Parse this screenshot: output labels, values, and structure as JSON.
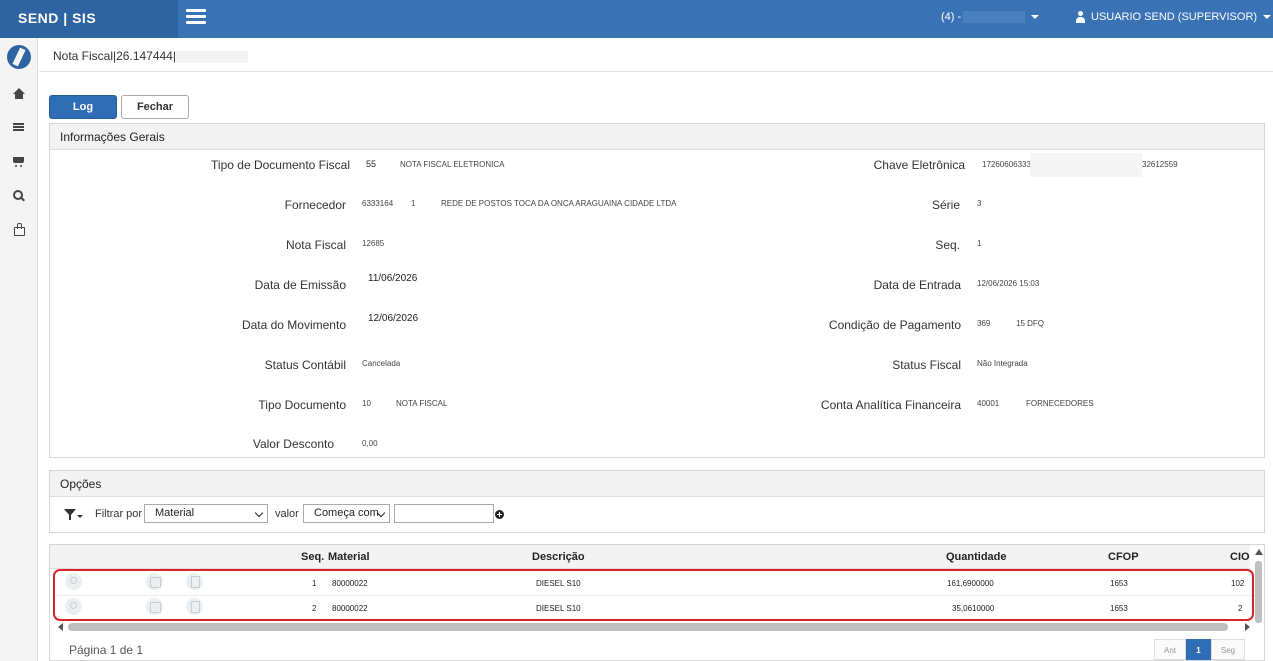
{
  "app": {
    "brand": "SEND | SIS",
    "company": "(4) -",
    "user": "USUARIO SEND (SUPERVISOR)"
  },
  "breadcrumb": "Nota Fiscal|26.147444|",
  "toolbar": {
    "log_label": "Log",
    "close_label": "Fechar"
  },
  "info": {
    "title": "Informações Gerais",
    "tipo_doc_fiscal": {
      "label": "Tipo de Documento Fiscal",
      "code": "55",
      "text": "NOTA FISCAL ELETRONICA"
    },
    "fornecedor": {
      "label": "Fornecedor",
      "code": "6333164",
      "seq": "1",
      "name": "REDE DE POSTOS TOCA DA ONCA ARAGUAINA CIDADE LTDA"
    },
    "nota_fiscal": {
      "label": "Nota Fiscal",
      "value": "12685"
    },
    "data_emissao": {
      "label": "Data de Emissão",
      "value": "11/06/2026"
    },
    "data_movimento": {
      "label": "Data do Movimento",
      "value": "12/06/2026"
    },
    "status_contabil": {
      "label": "Status Contábil",
      "value": "Cancelada"
    },
    "tipo_documento": {
      "label": "Tipo Documento",
      "code": "10",
      "text": "NOTA FISCAL"
    },
    "valor_desconto": {
      "label": "Valor Desconto",
      "value": "0,00"
    },
    "chave_eletronica": {
      "label": "Chave Eletrônica",
      "start": "17260606333",
      "end": "32612559"
    },
    "serie": {
      "label": "Série",
      "value": "3"
    },
    "seq": {
      "label": "Seq.",
      "value": "1"
    },
    "data_entrada": {
      "label": "Data de Entrada",
      "value": "12/06/2026 15:03"
    },
    "condicao_pagamento": {
      "label": "Condição de Pagamento",
      "code": "369",
      "text": "15 DFQ"
    },
    "status_fiscal": {
      "label": "Status Fiscal",
      "value": "Não Integrada"
    },
    "conta_analitica": {
      "label": "Conta Analítica Financeira",
      "code": "40001",
      "text": "FORNECEDORES"
    }
  },
  "options": {
    "title": "Opções",
    "filter_by_label": "Filtrar por",
    "filter_field": "Material",
    "value_label": "valor",
    "operator": "Começa com",
    "search_value": ""
  },
  "grid": {
    "headers": {
      "seq": "Seq.",
      "material": "Material",
      "descricao": "Descrição",
      "quantidade": "Quantidade",
      "cfop": "CFOP",
      "cio": "CIO"
    },
    "rows": [
      {
        "seq": "1",
        "material": "80000022",
        "descricao": "DIESEL S10",
        "quantidade": "161,6900000",
        "cfop": "1653",
        "cio": "102"
      },
      {
        "seq": "2",
        "material": "80000022",
        "descricao": "DIESEL S10",
        "quantidade": "35,0610000",
        "cfop": "1653",
        "cio": "2"
      }
    ]
  },
  "pager": {
    "info": "Página 1 de 1",
    "prev": "Ant",
    "current": "1",
    "next": "Seg"
  }
}
